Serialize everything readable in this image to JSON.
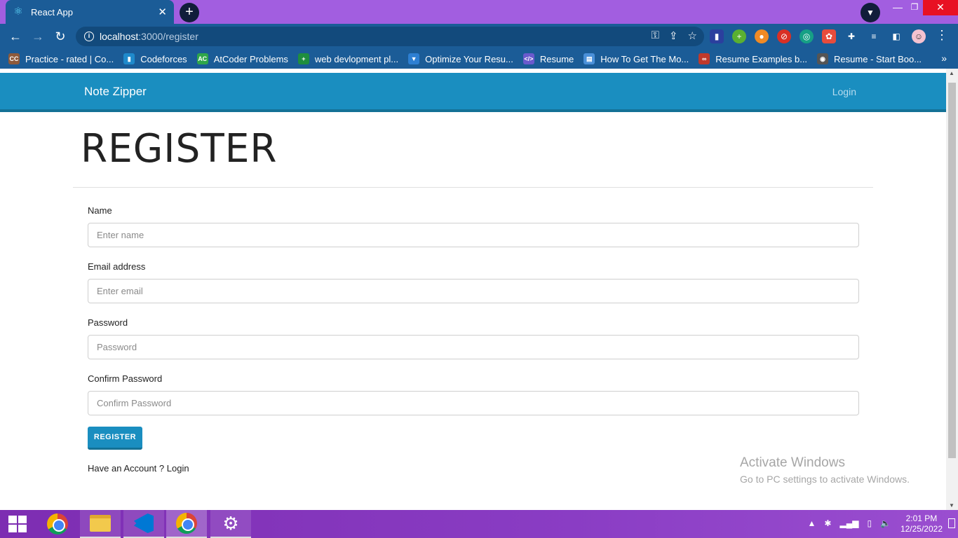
{
  "browser": {
    "tab_title": "React App",
    "url_host": "localhost",
    "url_path": ":3000/register",
    "bookmarks": [
      {
        "label": "Practice - rated | Co...",
        "icon": "cc",
        "color": "#8d5a3b"
      },
      {
        "label": "Codeforces",
        "icon": "bar",
        "color": "#1f8acb"
      },
      {
        "label": "AtCoder Problems",
        "icon": "AC",
        "color": "#2fa64a"
      },
      {
        "label": "web devlopment pl...",
        "icon": "+",
        "color": "#1e8e3e"
      },
      {
        "label": "Optimize Your Resu...",
        "icon": "tie",
        "color": "#2d7fd2"
      },
      {
        "label": "Resume",
        "icon": "</>",
        "color": "#6a5acd"
      },
      {
        "label": "How To Get The Mo...",
        "icon": "book",
        "color": "#4a90d9"
      },
      {
        "label": "Resume Examples b...",
        "icon": "@",
        "color": "#c0392b"
      },
      {
        "label": "Resume - Start Boo...",
        "icon": "globe",
        "color": "#555555"
      }
    ]
  },
  "navbar": {
    "brand": "Note Zipper",
    "login": "Login"
  },
  "page": {
    "title": "REGISTER"
  },
  "form": {
    "name_label": "Name",
    "name_placeholder": "Enter name",
    "email_label": "Email address",
    "email_placeholder": "Enter email",
    "password_label": "Password",
    "password_placeholder": "Password",
    "confirm_label": "Confirm Password",
    "confirm_placeholder": "Confirm Password",
    "submit_label": "REGISTER",
    "account_prompt": "Have an Account ? ",
    "account_link": "Login"
  },
  "watermark": {
    "title": "Activate Windows",
    "subtitle": "Go to PC settings to activate Windows."
  },
  "taskbar": {
    "time": "2:01 PM",
    "date": "12/25/2022"
  },
  "colors": {
    "accent": "#1a8ec0",
    "browser_frame": "#a25ee0",
    "browser_toolbar": "#1b5c97"
  }
}
